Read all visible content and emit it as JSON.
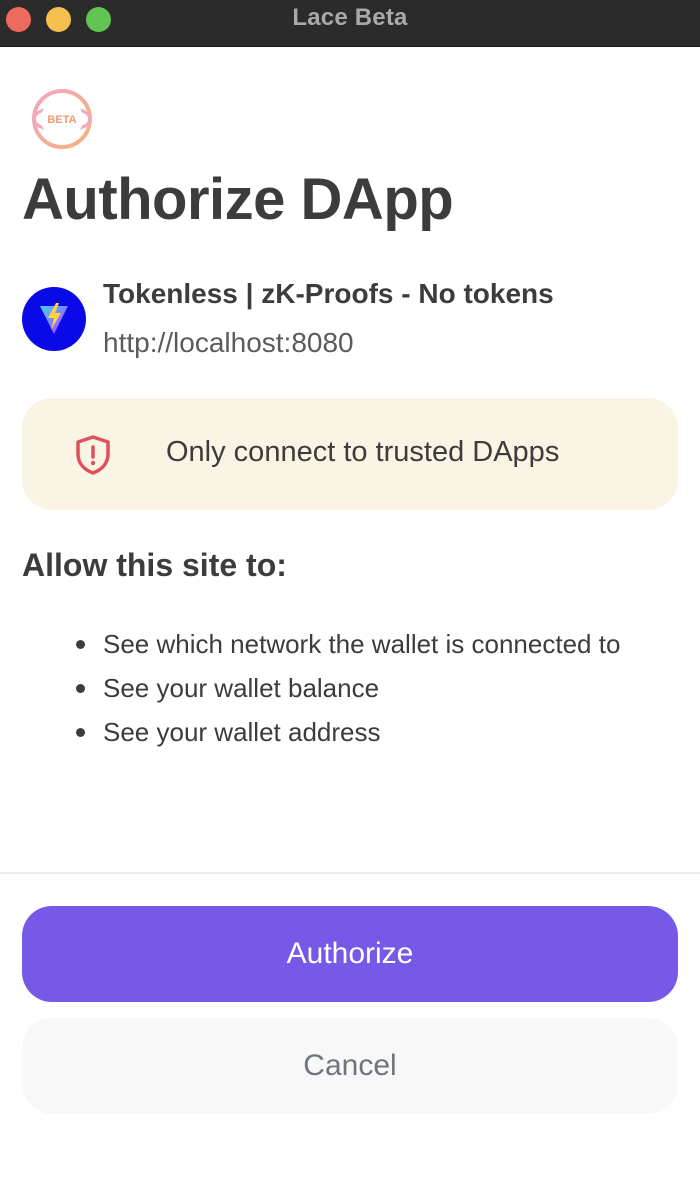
{
  "window": {
    "title": "Lace Beta"
  },
  "logo": {
    "badge_text": "BETA"
  },
  "page": {
    "heading": "Authorize DApp"
  },
  "dapp": {
    "name": "Tokenless | zK-Proofs - No tokens",
    "url": "http://localhost:8080",
    "icon": "vite-logo-icon"
  },
  "warning": {
    "icon": "shield-alert-icon",
    "text": "Only connect to trusted DApps"
  },
  "permissions": {
    "title": "Allow this site to:",
    "items": [
      "See which network the wallet is connected to",
      "See your wallet balance",
      "See your wallet address"
    ]
  },
  "actions": {
    "authorize_label": "Authorize",
    "cancel_label": "Cancel"
  },
  "colors": {
    "primary": "#7659e6",
    "warning_bg": "#faf4e4",
    "warning_icon": "#e0505c",
    "dapp_avatar_bg": "#0a0ae8"
  }
}
